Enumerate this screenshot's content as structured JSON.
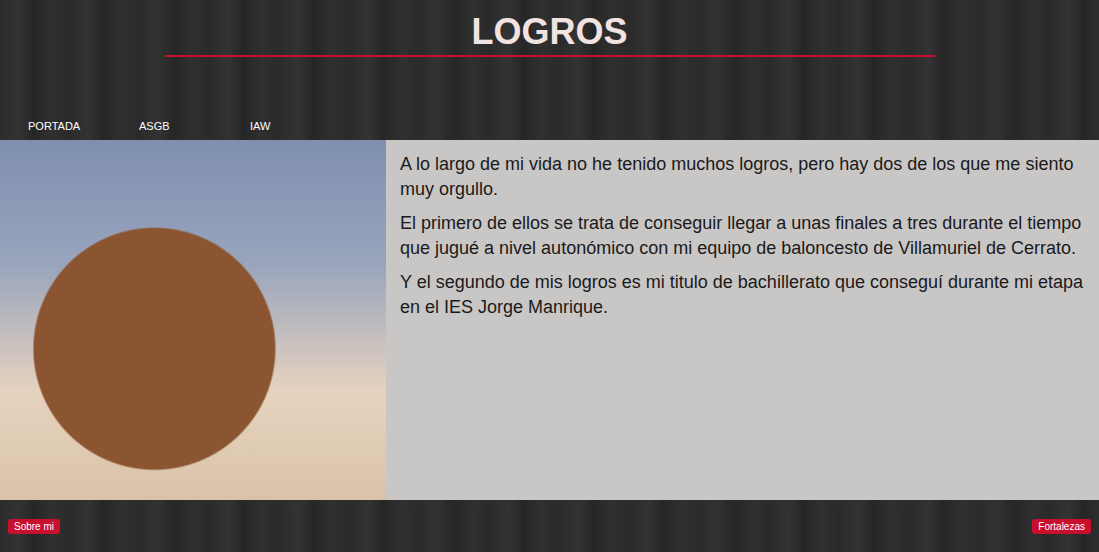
{
  "header": {
    "title": "LOGROS"
  },
  "nav": [
    "PORTADA",
    "ASGB",
    "IAW"
  ],
  "content": {
    "paragraphs": [
      "A lo largo de mi vida no he tenido muchos logros, pero hay dos de los que me siento muy orgullo.",
      "El primero de ellos se trata de conseguir llegar a unas finales a tres durante el tiempo que jugué a nivel autonómico con mi equipo de baloncesto de Villamuriel de Cerrato.",
      "Y el segundo de mis logros es mi titulo de bachillerato que conseguí durante mi etapa en el IES Jorge Manrique."
    ]
  },
  "footer": {
    "buttons": [
      "Sobre mi",
      "Fortalezas"
    ]
  }
}
